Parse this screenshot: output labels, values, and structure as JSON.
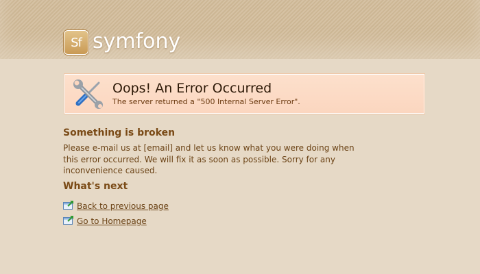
{
  "brand": {
    "badge": "Sf",
    "name": "symfony"
  },
  "error": {
    "title": "Oops! An Error Occurred",
    "message": "The server returned a \"500 Internal Server Error\".",
    "icon": "wrench-screwdriver-icon"
  },
  "broken": {
    "heading": "Something is broken",
    "text": "Please e-mail us at [email] and let us know what you were doing when this error occurred. We will fix it as soon as possible. Sorry for any inconvenience caused."
  },
  "next": {
    "heading": "What's next",
    "links": [
      {
        "label": "Back to previous page",
        "icon": "external-link-icon"
      },
      {
        "label": "Go to Homepage",
        "icon": "external-link-icon"
      }
    ]
  },
  "colors": {
    "background": "#e6d9c6",
    "error_box": "#fbd6bf",
    "text": "#6b4316"
  }
}
